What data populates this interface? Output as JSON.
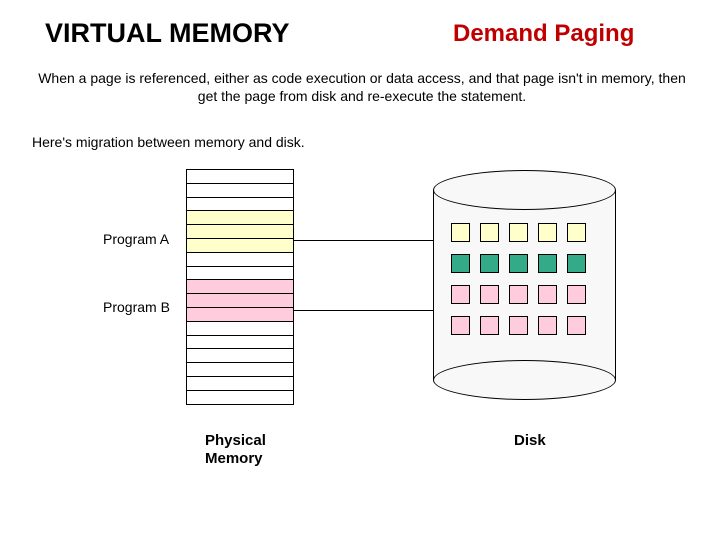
{
  "titles": {
    "main": "VIRTUAL MEMORY",
    "sub": "Demand Paging"
  },
  "description": "When a page is referenced, either as code execution or data access, and that page isn't in memory, then get the page from disk and re-execute the statement.",
  "caption": "Here's  migration between memory and disk.",
  "labels": {
    "programA": "Program A",
    "programB": "Program B",
    "physicalMemory": "Physical\nMemory",
    "disk": "Disk"
  },
  "memory_rows": [
    {
      "fill": "none"
    },
    {
      "fill": "none"
    },
    {
      "fill": "none"
    },
    {
      "fill": "yellow"
    },
    {
      "fill": "yellow"
    },
    {
      "fill": "yellow"
    },
    {
      "fill": "none"
    },
    {
      "fill": "none"
    },
    {
      "fill": "pink"
    },
    {
      "fill": "pink"
    },
    {
      "fill": "pink"
    },
    {
      "fill": "none"
    },
    {
      "fill": "none"
    },
    {
      "fill": "none"
    },
    {
      "fill": "none"
    },
    {
      "fill": "none"
    },
    {
      "fill": "none"
    }
  ],
  "disk_rows": [
    {
      "color": "yellow",
      "count": 5
    },
    {
      "color": "green",
      "count": 5
    },
    {
      "color": "pink",
      "count": 5
    },
    {
      "color": "pink",
      "count": 5
    }
  ],
  "colors": {
    "accent": "#c00000",
    "yellow": "#ffffcc",
    "pink": "#ffccdd",
    "green": "#33aa88"
  }
}
